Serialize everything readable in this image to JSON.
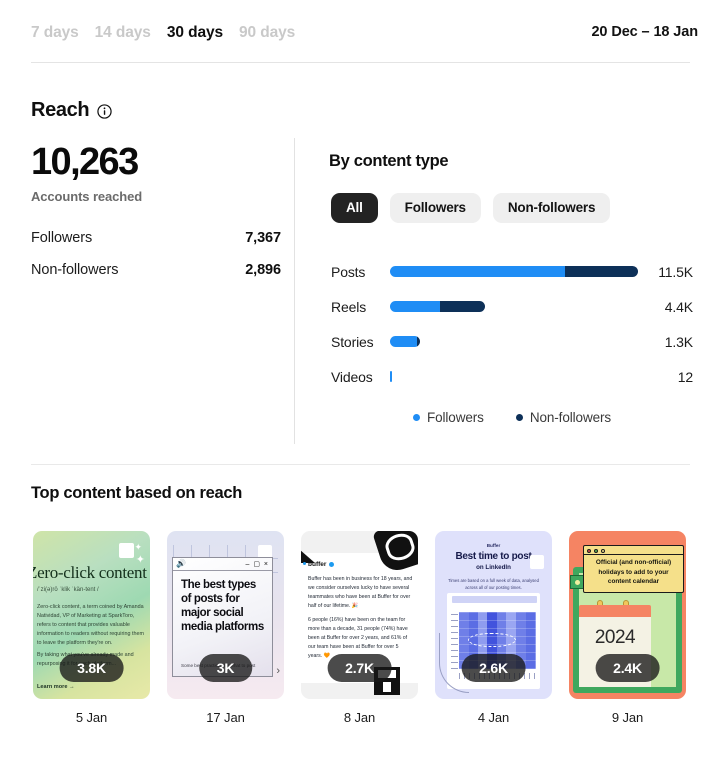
{
  "period_bar": {
    "tabs": [
      {
        "label": "7 days",
        "active": false
      },
      {
        "label": "14 days",
        "active": false
      },
      {
        "label": "30 days",
        "active": true
      },
      {
        "label": "90 days",
        "active": false
      }
    ],
    "date_range": "20 Dec – 18 Jan"
  },
  "reach": {
    "title": "Reach",
    "info_icon": "info-circle-icon",
    "total": "10,263",
    "total_caption": "Accounts reached",
    "breakdown": [
      {
        "label": "Followers",
        "value": "7,367"
      },
      {
        "label": "Non-followers",
        "value": "2,896"
      }
    ]
  },
  "by_content_type": {
    "title": "By content type",
    "pills": [
      {
        "label": "All",
        "selected": true
      },
      {
        "label": "Followers",
        "selected": false
      },
      {
        "label": "Non-followers",
        "selected": false
      }
    ],
    "legend": [
      {
        "label": "Followers",
        "color": "#1f8df5"
      },
      {
        "label": "Non-followers",
        "color": "#0d3058"
      }
    ]
  },
  "chart_data": {
    "type": "bar",
    "title": "By content type",
    "orientation": "horizontal",
    "stacked": true,
    "categories": [
      "Posts",
      "Reels",
      "Stories",
      "Videos"
    ],
    "value_labels": [
      "11.5K",
      "4.4K",
      "1.3K",
      "12"
    ],
    "values": [
      11500,
      4400,
      1300,
      12
    ],
    "series": [
      {
        "name": "Followers",
        "color": "#1f8df5",
        "values": [
          8100,
          2300,
          1250,
          10
        ]
      },
      {
        "name": "Non-followers",
        "color": "#0d3058",
        "values": [
          3400,
          2100,
          50,
          2
        ]
      }
    ],
    "xlabel": "",
    "ylabel": "",
    "xlim": [
      0,
      11500
    ],
    "grid": false,
    "legend_position": "bottom-center"
  },
  "top_content": {
    "title": "Top content based on reach",
    "cards": [
      {
        "badge": "3.8K",
        "date": "5 Jan",
        "heading": "Zero-click content",
        "subheading": "/ˈzi(ə)rō ˈklik ˈkän-tent /",
        "body": "Zero-click content, a term coined by Amanda Natividad, VP of Marketing at SparkToro, refers to content that provides valuable information to readers without requiring them to leave the platform they're on.",
        "body2": "By taking what you've already made and repurposing it for each platform...",
        "more": "Learn more →"
      },
      {
        "badge": "3K",
        "date": "17 Jan",
        "heading": "The best types of posts for major social media platforms",
        "subheading": "Some best practices for what to post",
        "window_controls": "– ▢ ×",
        "speaker_icon": "speaker-icon"
      },
      {
        "badge": "2.7K",
        "date": "8 Jan",
        "account": "buffer",
        "verified_icon": "verified-badge-icon",
        "paragraph1": "Buffer has been in business for 18 years, and we consider ourselves lucky to have several teammates who have been at Buffer for over half of our lifetime. 🎉",
        "paragraph2": "6 people (16%) have been on the team for more than a decade, 31 people (74%) have been at Buffer for over 2 years, and 61% of our team have been at Buffer for over 5 years. 🧡"
      },
      {
        "badge": "2.6K",
        "date": "4 Jan",
        "brand": "Buffer",
        "heading": "Best time to post",
        "subheading": "on LinkedIn",
        "note": "Times are based on a full week of data, analysed across all of our posting times."
      },
      {
        "badge": "2.4K",
        "date": "9 Jan",
        "note_text": "Official (and non-official) holidays to add to your content calendar",
        "calendar_year": "2024"
      }
    ]
  }
}
